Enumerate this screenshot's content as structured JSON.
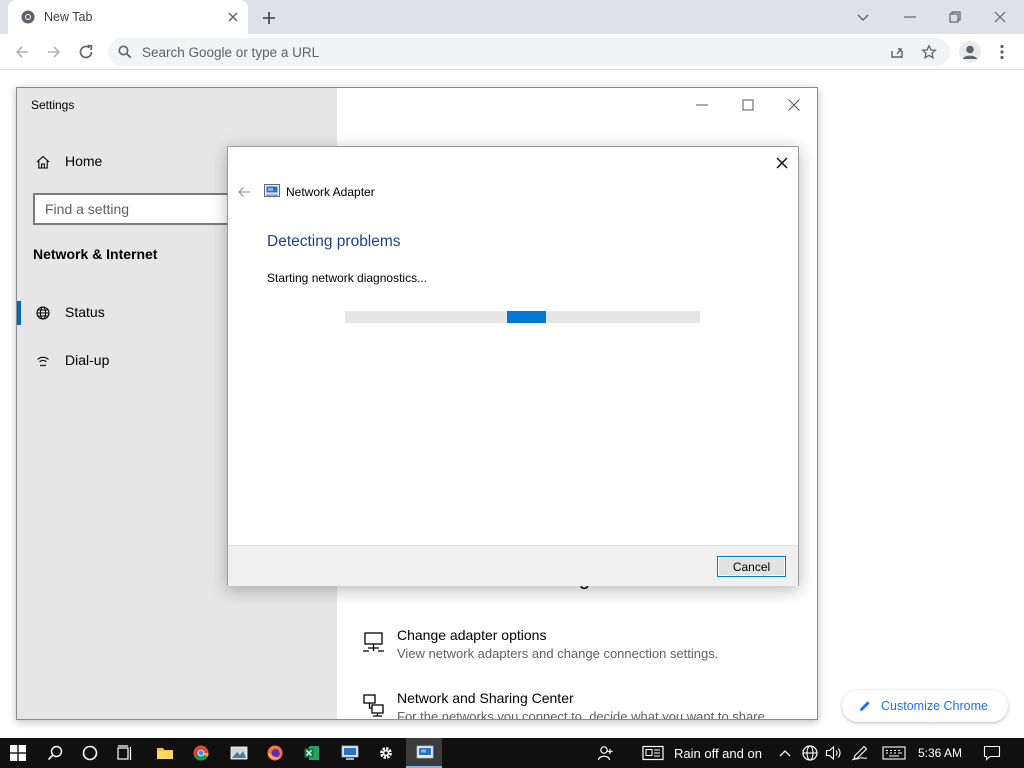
{
  "browser": {
    "tab_title": "New Tab",
    "omnibox_placeholder": "Search Google or type a URL",
    "customize_label": "Customize Chrome",
    "icons": [
      "chrome-logo-icon",
      "close-icon",
      "plus-icon",
      "chevron-down-icon",
      "minimize-icon",
      "restore-icon",
      "back-arrow-icon",
      "forward-arrow-icon",
      "reload-icon",
      "search-icon",
      "share-icon",
      "star-icon",
      "avatar-icon",
      "more-vertical-icon",
      "pencil-icon"
    ]
  },
  "settings": {
    "window_title": "Settings",
    "home_label": "Home",
    "search_placeholder": "Find a setting",
    "section_heading": "Network & Internet",
    "nav_items": [
      {
        "label": "Status",
        "icon": "globe-icon",
        "active": true
      },
      {
        "label": "Dial-up",
        "icon": "dialup-icon",
        "active": false
      }
    ],
    "advanced_heading": "Advanced network settings",
    "advanced_items": [
      {
        "title": "Change adapter options",
        "description": "View network adapters and change connection settings.",
        "icon": "network-adapter-icon"
      },
      {
        "title": "Network and Sharing Center",
        "description": "For the networks you connect to, decide what you want to share.",
        "icon": "sharing-center-icon"
      }
    ]
  },
  "troubleshooter": {
    "app_title": "Network Adapter",
    "heading": "Detecting problems",
    "status_text": "Starting network diagnostics...",
    "cancel_label": "Cancel",
    "progress": {
      "type": "indeterminate",
      "marquee_start_fraction": 0.455,
      "marquee_width_fraction": 0.11
    },
    "accent_color": "#0078d7"
  },
  "taskbar": {
    "apps": [
      "windows-start-icon",
      "search-icon",
      "cortana-icon",
      "task-view-icon",
      "file-explorer-icon",
      "chrome-icon",
      "photos-icon",
      "firefox-icon",
      "excel-icon",
      "network-icon",
      "settings-gear-icon",
      "troubleshooter-icon"
    ],
    "weather_text": "Rain off and on",
    "clock_time": "5:36 AM",
    "tray_icons": [
      "people-icon",
      "news-icon",
      "chevron-up-icon",
      "network-globe-icon",
      "volume-icon",
      "pen-icon",
      "keyboard-icon",
      "notification-icon"
    ]
  }
}
